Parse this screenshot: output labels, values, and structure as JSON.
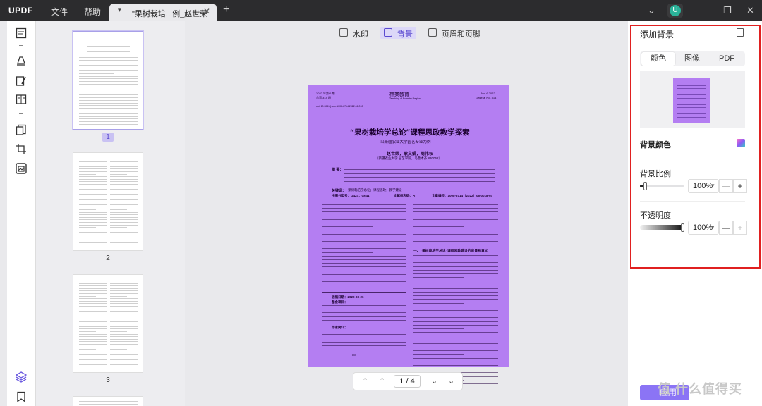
{
  "app": {
    "logo": "UPDF",
    "menu": [
      "文件",
      "帮助"
    ]
  },
  "tab": {
    "title": "\"果树栽培...例_赵世荣",
    "caret": "▾",
    "close": "✕",
    "add": "+"
  },
  "window": {
    "minimize": "—",
    "maximize": "❐",
    "close": "✕",
    "dropdown": "⌄",
    "avatar": "U"
  },
  "toolbar": {
    "icons": [
      "reader-icon",
      "highlight-icon",
      "edit-text-icon",
      "organize-icon",
      "convert-icon",
      "crop-icon",
      "page-tools-icon",
      "layers-icon",
      "bookmark-icon"
    ]
  },
  "thumbnails": [
    {
      "number": "1",
      "selected": true
    },
    {
      "number": "2",
      "selected": false
    },
    {
      "number": "3",
      "selected": false
    }
  ],
  "main": {
    "buttons": [
      {
        "label": "水印",
        "icon": "watermark-icon",
        "active": false
      },
      {
        "label": "背景",
        "icon": "background-icon",
        "active": true
      },
      {
        "label": "页眉和页脚",
        "icon": "header-footer-icon",
        "active": false
      }
    ],
    "document": {
      "header_left_1": "2022 年第 6 期",
      "header_left_2": "总第 314 期",
      "journal_name": "林業教育",
      "journal_en": "Teaching of Forestry Region",
      "header_right_1": "No. 6  2022",
      "header_right_2": "General No. 314",
      "doi": "doi: 10.3969/j.issn.1008-6714.2022.06.010",
      "title": "“果树栽培学总论”课程思政教学探索",
      "subtitle": "——以新疆农业大学园艺专业为例",
      "authors": "赵世荣，耿文娟，周伟权",
      "affiliation": "（新疆农业大学 园艺学院，乌鲁木齐 830052）",
      "abstract_label": "摘  要：",
      "keywords_label": "关键词：",
      "keywords": "果树栽培学总论；课程思政；教学建设",
      "clc": "中图分类号：G424；G641",
      "code": "文献标志码：A",
      "article_no": "文章编号：1008-6714（2022）06-0018-04",
      "section_heading": "一、“果树栽培学总论”课程思政建设的背景和意义",
      "received": "收稿日期：2022-03-26",
      "fund": "基金项目：",
      "author_info": "作者简介：",
      "page_number": "· 18 ·"
    },
    "pager": {
      "first": "⌃",
      "prev": "⌃",
      "current": "1 / 4",
      "next": "⌄",
      "last": "⌄"
    }
  },
  "panel": {
    "title": "添加背景",
    "tabs": [
      "颜色",
      "图像",
      "PDF"
    ],
    "active_tab": "颜色",
    "color_label": "背景颜色",
    "ratio_label": "背景比例",
    "ratio_value": "100%",
    "ratio_fraction": 0.08,
    "opacity_label": "不透明度",
    "opacity_value": "100%",
    "opacity_fraction": 1.0,
    "minus": "—",
    "plus": "+",
    "apply_label": "应用",
    "background_color": "#b47ef2"
  },
  "overlay_watermark": "值 什么值得买",
  "colors": {
    "accent": "#8b74f5",
    "highlight_box": "#e02020",
    "page_background": "#b47ef2"
  }
}
